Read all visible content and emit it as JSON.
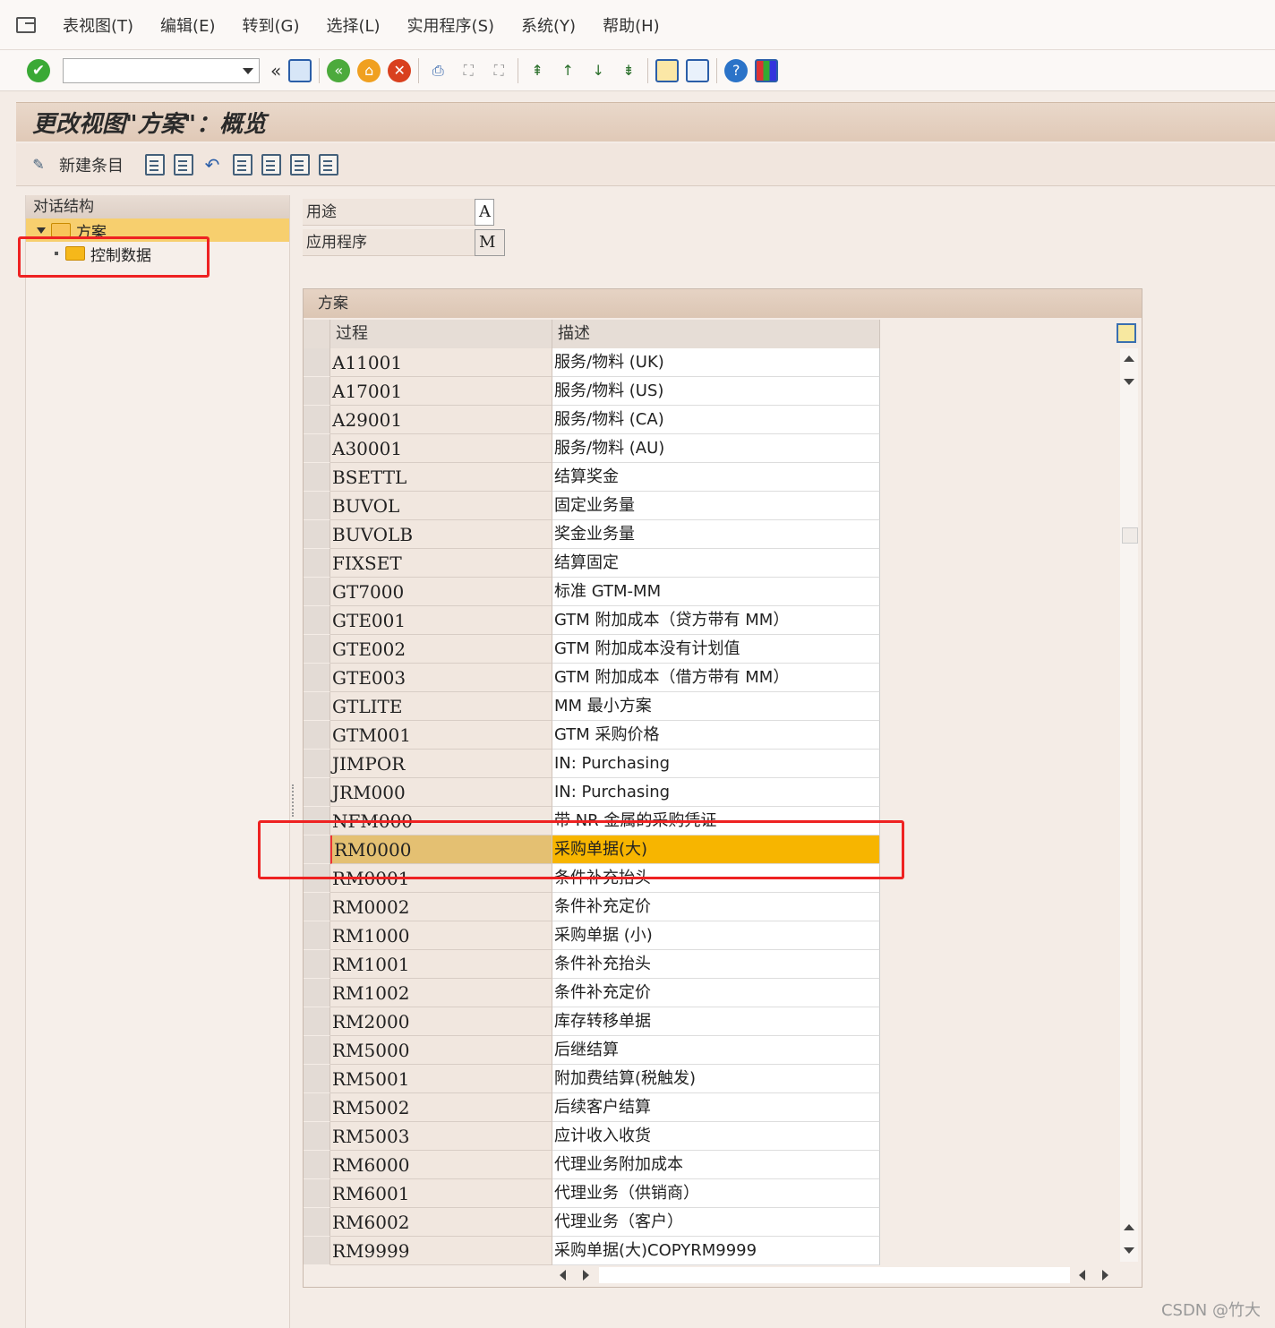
{
  "menubar": {
    "items": [
      "表视图(T)",
      "编辑(E)",
      "转到(G)",
      "选择(L)",
      "实用程序(S)",
      "系统(Y)",
      "帮助(H)"
    ]
  },
  "toolbar": {
    "command_field_value": ""
  },
  "title": "更改视图\"方案\"：概览",
  "app_toolbar": {
    "new_entry_label": "新建条目"
  },
  "tree": {
    "header": "对话结构",
    "nodes": [
      {
        "label": "方案",
        "expanded": true,
        "selected": true
      },
      {
        "label": "控制数据",
        "expanded": false,
        "selected": false
      }
    ]
  },
  "fields": [
    {
      "label": "用途",
      "value": "A"
    },
    {
      "label": "应用程序",
      "value": "M"
    }
  ],
  "table": {
    "caption": "方案",
    "columns": [
      "过程",
      "描述"
    ],
    "rows": [
      {
        "proc": "A11001",
        "desc": "服务/物料 (UK)"
      },
      {
        "proc": "A17001",
        "desc": "服务/物料 (US)"
      },
      {
        "proc": "A29001",
        "desc": "服务/物料 (CA)"
      },
      {
        "proc": "A30001",
        "desc": "服务/物料 (AU)"
      },
      {
        "proc": "BSETTL",
        "desc": "结算奖金"
      },
      {
        "proc": "BUVOL",
        "desc": "固定业务量"
      },
      {
        "proc": "BUVOLB",
        "desc": "奖金业务量"
      },
      {
        "proc": "FIXSET",
        "desc": "结算固定"
      },
      {
        "proc": "GT7000",
        "desc": "标准 GTM-MM"
      },
      {
        "proc": "GTE001",
        "desc": "GTM 附加成本（贷方带有 MM）"
      },
      {
        "proc": "GTE002",
        "desc": "GTM 附加成本没有计划值"
      },
      {
        "proc": "GTE003",
        "desc": "GTM 附加成本（借方带有 MM）"
      },
      {
        "proc": "GTLITE",
        "desc": "MM 最小方案"
      },
      {
        "proc": "GTM001",
        "desc": "GTM 采购价格"
      },
      {
        "proc": "JIMPOR",
        "desc": "IN: Purchasing"
      },
      {
        "proc": "JRM000",
        "desc": "IN: Purchasing"
      },
      {
        "proc": "NFM000",
        "desc": "带 NR 金属的采购凭证"
      },
      {
        "proc": "RM0000",
        "desc": "采购单据(大)",
        "selected": true
      },
      {
        "proc": "RM0001",
        "desc": "条件补充抬头"
      },
      {
        "proc": "RM0002",
        "desc": "条件补充定价"
      },
      {
        "proc": "RM1000",
        "desc": "采购单据 (小)"
      },
      {
        "proc": "RM1001",
        "desc": "条件补充抬头"
      },
      {
        "proc": "RM1002",
        "desc": "条件补充定价"
      },
      {
        "proc": "RM2000",
        "desc": "库存转移单据"
      },
      {
        "proc": "RM5000",
        "desc": "后继结算"
      },
      {
        "proc": "RM5001",
        "desc": "附加费结算(税触发)"
      },
      {
        "proc": "RM5002",
        "desc": "后续客户结算"
      },
      {
        "proc": "RM5003",
        "desc": "应计收入收货"
      },
      {
        "proc": "RM6000",
        "desc": "代理业务附加成本"
      },
      {
        "proc": "RM6001",
        "desc": "代理业务（供销商）"
      },
      {
        "proc": "RM6002",
        "desc": "代理业务（客户）"
      },
      {
        "proc": "RM9999",
        "desc": "采购单据(大)COPYRM9999"
      }
    ]
  },
  "watermark": "CSDN @竹大",
  "colors": {
    "selected_row": "#f7b500",
    "highlight_box": "#ee2222",
    "title_bg": "#e0c9b7"
  }
}
